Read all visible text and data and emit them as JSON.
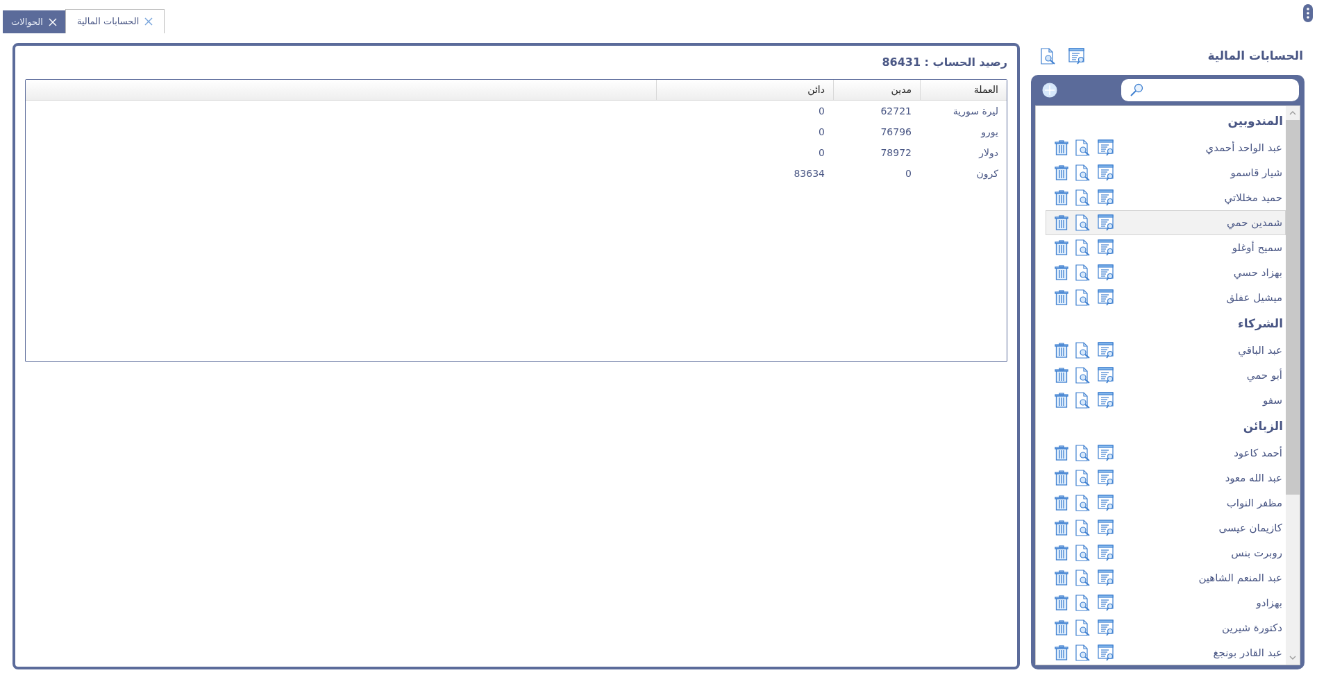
{
  "tabs": [
    {
      "label": "الحسابات المالية",
      "selected": true
    },
    {
      "label": "الحوالات",
      "selected": false
    }
  ],
  "main": {
    "balance": "رصيد الحساب : 86431",
    "table": {
      "columns": [
        "العملة",
        "مدين",
        "دائن"
      ],
      "rows": [
        [
          "ليرة سورية",
          "62721",
          "0"
        ],
        [
          "يورو",
          "76796",
          "0"
        ],
        [
          "دولار",
          "78972",
          "0"
        ],
        [
          "كرون",
          "0",
          "83634"
        ]
      ]
    }
  },
  "sidebar": {
    "title": "الحسابات المالية",
    "groups": [
      {
        "title": "المندوبين",
        "items": [
          {
            "name": "عبد الواحد أحمدي",
            "selected": false
          },
          {
            "name": "شيار قاسمو",
            "selected": false
          },
          {
            "name": "حميد مخللاتي",
            "selected": false
          },
          {
            "name": "شمدين حمي",
            "selected": true
          },
          {
            "name": "سميح أوغلو",
            "selected": false
          },
          {
            "name": "بهزاد حسي",
            "selected": false
          },
          {
            "name": "ميشيل عفلق",
            "selected": false
          }
        ]
      },
      {
        "title": "الشركاء",
        "items": [
          {
            "name": "عبد الباقي",
            "selected": false
          },
          {
            "name": "أبو حمي",
            "selected": false
          },
          {
            "name": "سفو",
            "selected": false
          }
        ]
      },
      {
        "title": "الزبائن",
        "items": [
          {
            "name": "أحمد كاعود",
            "selected": false
          },
          {
            "name": "عبد الله معود",
            "selected": false
          },
          {
            "name": "مظفر النواب",
            "selected": false
          },
          {
            "name": "كازيمان عيسى",
            "selected": false
          },
          {
            "name": "روبرت بنس",
            "selected": false
          },
          {
            "name": "عبد المنعم الشاهين",
            "selected": false
          },
          {
            "name": "بهزادو",
            "selected": false
          },
          {
            "name": "دكتورة شيرين",
            "selected": false
          },
          {
            "name": "عبد القادر بونجغ",
            "selected": false
          }
        ]
      }
    ]
  }
}
